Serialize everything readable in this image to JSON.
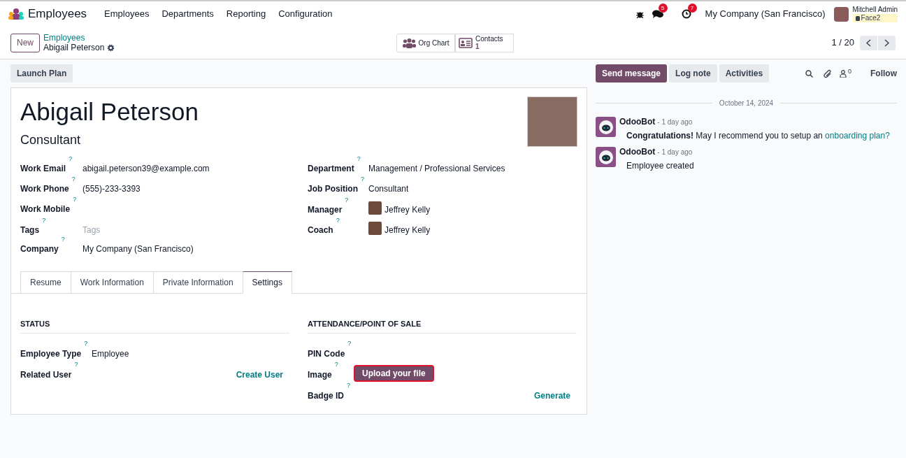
{
  "navbar": {
    "app_name": "Employees",
    "menu": [
      "Employees",
      "Departments",
      "Reporting",
      "Configuration"
    ],
    "messages_count": "5",
    "activities_count": "7",
    "company": "My Company (San Francisco)",
    "user_name": "Mitchell Admin",
    "database": "Face2"
  },
  "control_panel": {
    "new_button": "New",
    "breadcrumb": "Employees",
    "record_name": "Abigail Peterson",
    "smart_buttons": [
      {
        "kind": "org",
        "label": "Org Chart"
      },
      {
        "kind": "contacts",
        "label": "Contacts",
        "count": "1"
      }
    ],
    "pager": "1 / 20"
  },
  "action_buttons": [
    "Launch Plan"
  ],
  "form": {
    "name": "Abigail Peterson",
    "job_title": "Consultant",
    "left_fields": [
      {
        "label": "Work Email",
        "help": "?",
        "kind": "text",
        "value": "abigail.peterson39@example.com"
      },
      {
        "label": "Work Phone",
        "help": "?",
        "kind": "text",
        "value": "(555)-233-3393"
      },
      {
        "label": "Work Mobile",
        "help": "?",
        "kind": "empty"
      },
      {
        "label": "Tags",
        "help": "?",
        "kind": "placeholder",
        "placeholder": "Tags"
      },
      {
        "label": "Company",
        "help": "?",
        "kind": "text",
        "value": "My Company (San Francisco)"
      }
    ],
    "right_fields": [
      {
        "label": "Department",
        "help": "?",
        "kind": "text",
        "value": "Management / Professional Services"
      },
      {
        "label": "Job Position",
        "help": "?",
        "kind": "text",
        "value": "Consultant"
      },
      {
        "label": "Manager",
        "help": "?",
        "kind": "person",
        "value": "Jeffrey Kelly"
      },
      {
        "label": "Coach",
        "help": "?",
        "kind": "person",
        "value": "Jeffrey Kelly"
      }
    ],
    "tabs": [
      {
        "label": "Resume",
        "selected": false
      },
      {
        "label": "Work Information",
        "selected": false
      },
      {
        "label": "Private Information",
        "selected": false
      },
      {
        "label": "Settings",
        "selected": true
      }
    ],
    "sections": [
      {
        "title": "STATUS",
        "fields": [
          {
            "label": "Employee Type",
            "help": "?",
            "kind": "text",
            "value": "Employee"
          },
          {
            "label": "Related User",
            "help": "?",
            "kind": "link",
            "value": "Create User"
          }
        ]
      },
      {
        "title": "ATTENDANCE/POINT OF SALE",
        "fields": [
          {
            "label": "PIN Code",
            "help": "?",
            "kind": "empty"
          },
          {
            "label": "Image",
            "help": "?",
            "kind": "button",
            "value": "Upload your file"
          },
          {
            "label": "Badge ID",
            "help": "?",
            "kind": "link",
            "value": "Generate"
          }
        ]
      }
    ]
  },
  "chatter": {
    "buttons": [
      {
        "label": "Send message",
        "selected": true
      },
      {
        "label": "Log note",
        "selected": false
      },
      {
        "label": "Activities",
        "selected": false
      }
    ],
    "followers_count": "0",
    "follow": "Follow",
    "date": "October 14, 2024",
    "messages": [
      {
        "author": "OdooBot",
        "time": "- 1 day ago",
        "body": "**Congratulations!** May I recommend you to setup an",
        "link": "onboarding plan?"
      },
      {
        "author": "OdooBot",
        "time": "- 1 day ago",
        "body": "Employee created"
      }
    ]
  }
}
